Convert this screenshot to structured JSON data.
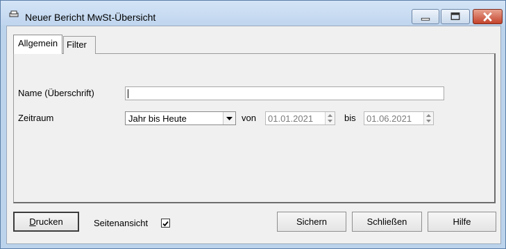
{
  "window": {
    "title": "Neuer Bericht MwSt-Übersicht",
    "app_icon": "report-print-icon",
    "controls": [
      "minimize-icon",
      "maximize-icon",
      "close-icon"
    ]
  },
  "tabs": [
    {
      "label": "Allgemein",
      "selected": true
    },
    {
      "label": "Filter",
      "selected": false
    }
  ],
  "form": {
    "name_label": "Name (Überschrift)",
    "name_value": "",
    "period_label": "Zeitraum",
    "period_value": "Jahr bis Heute",
    "from_label": "von",
    "from_value": "01.01.2021",
    "to_label": "bis",
    "to_value": "01.06.2021"
  },
  "footer": {
    "print_label": "Drucken",
    "print_mnemonic": "D",
    "preview_label": "Seitenansicht",
    "preview_checked": true,
    "save_label": "Sichern",
    "close_label": "Schließen",
    "help_label": "Hilfe"
  },
  "colors": {
    "frame": "#bcd3ec",
    "close_button": "#c4432b",
    "dialog_bg": "#f0f0f0"
  }
}
